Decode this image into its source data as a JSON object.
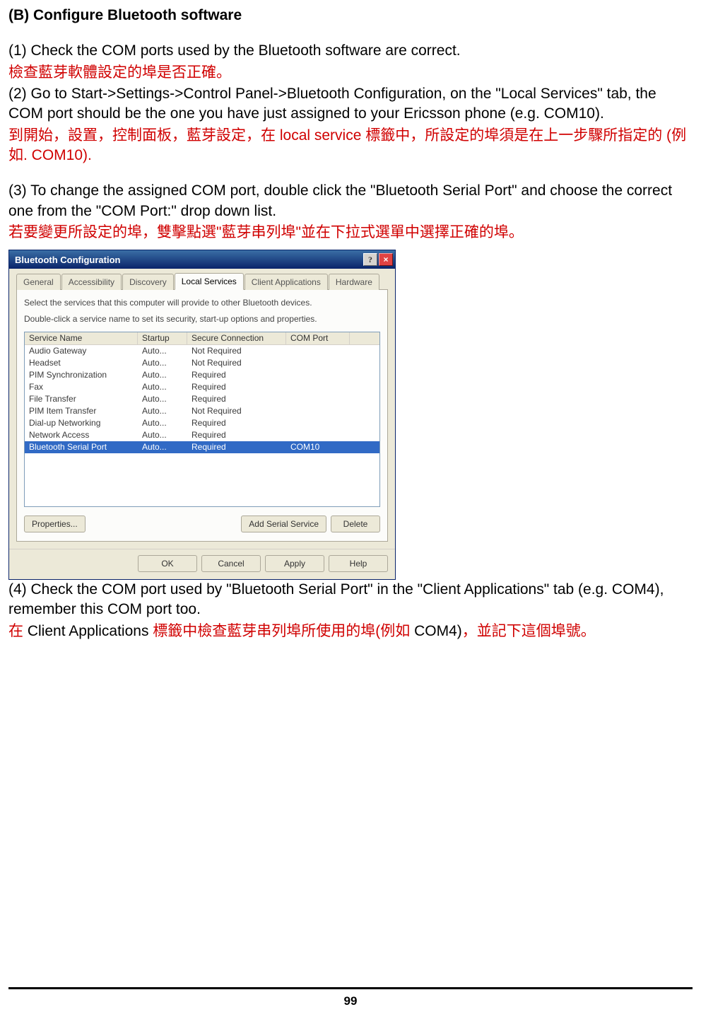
{
  "heading": "(B) Configure Bluetooth software",
  "text": {
    "p1": "(1) Check the COM ports used by the Bluetooth software are correct.",
    "p1_cn": "檢查藍芽軟體設定的埠是否正確。",
    "p2": "(2) Go to Start->Settings->Control Panel->Bluetooth Configuration, on the \"Local Services\" tab, the COM port should be the one you have just assigned to your Ericsson phone (e.g. COM10).",
    "p2_cn_a": "到開始，設置，控制面板，藍芽設定，在 ",
    "p2_cn_mid": "local service",
    "p2_cn_b": " 標籤中，所設定的埠須是在上一步驟所指定的 (",
    "p2_cn_c": "例如",
    "p2_cn_d": ". COM10).",
    "p3": "(3) To change the assigned COM port, double click the \"Bluetooth Serial Port\" and choose the correct one from the \"COM Port:\" drop down list.",
    "p3_cn": "若要變更所設定的埠，雙擊點選\"藍芽串列埠\"並在下拉式選單中選擇正確的埠。",
    "p4": "(4) Check the COM port used by \"Bluetooth Serial Port\" in the \"Client Applications\" tab (e.g. COM4), remember this COM port too.",
    "p4_cn_a": "在 ",
    "p4_cn_app": "Client Applications",
    "p4_cn_b": " 標籤中檢查藍芽串列埠所使用的埠(",
    "p4_cn_c": "例如",
    "p4_cn_d": " COM4)",
    "p4_cn_e": "，並記下這個埠號。"
  },
  "dialog": {
    "title": "Bluetooth Configuration",
    "help_btn": "?",
    "close_btn": "×",
    "tabs": [
      "General",
      "Accessibility",
      "Discovery",
      "Local Services",
      "Client Applications",
      "Hardware"
    ],
    "active_tab_index": 3,
    "desc1": "Select the services that this computer will provide to other Bluetooth devices.",
    "desc2": "Double-click a service name to set its security, start-up options and properties.",
    "columns": [
      "Service Name",
      "Startup",
      "Secure Connection",
      "COM Port"
    ],
    "rows": [
      {
        "name": "Audio Gateway",
        "startup": "Auto...",
        "secure": "Not Required",
        "com": ""
      },
      {
        "name": "Headset",
        "startup": "Auto...",
        "secure": "Not Required",
        "com": ""
      },
      {
        "name": "PIM Synchronization",
        "startup": "Auto...",
        "secure": "Required",
        "com": ""
      },
      {
        "name": "Fax",
        "startup": "Auto...",
        "secure": "Required",
        "com": ""
      },
      {
        "name": "File Transfer",
        "startup": "Auto...",
        "secure": "Required",
        "com": ""
      },
      {
        "name": "PIM Item Transfer",
        "startup": "Auto...",
        "secure": "Not Required",
        "com": ""
      },
      {
        "name": "Dial-up Networking",
        "startup": "Auto...",
        "secure": "Required",
        "com": ""
      },
      {
        "name": "Network Access",
        "startup": "Auto...",
        "secure": "Required",
        "com": ""
      },
      {
        "name": "Bluetooth Serial Port",
        "startup": "Auto...",
        "secure": "Required",
        "com": "COM10"
      }
    ],
    "selected_row_index": 8,
    "buttons": {
      "properties": "Properties...",
      "add": "Add Serial Service",
      "delete": "Delete",
      "ok": "OK",
      "cancel": "Cancel",
      "apply": "Apply",
      "help": "Help"
    }
  },
  "page_number": "99"
}
